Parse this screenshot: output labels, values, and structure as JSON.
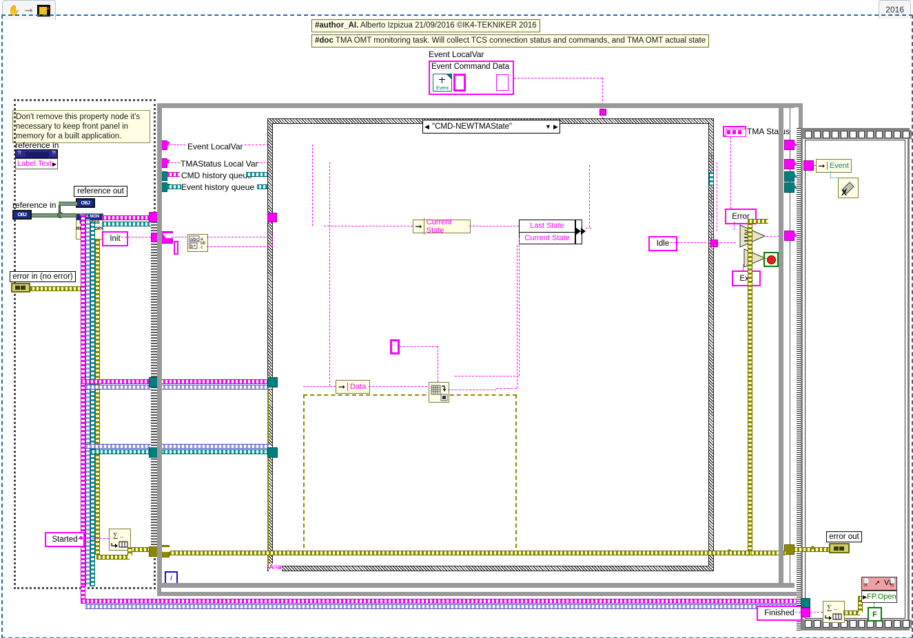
{
  "window": {
    "tab_year": "2016",
    "toolbar_icons": [
      "hand-icon",
      "arrow-icon",
      "vi-icon"
    ]
  },
  "documentation": {
    "author_tag": "#author_AI.",
    "author_text": "Alberto Izpizua 21/09/2016 ©IK4-TEKNIKER 2016",
    "doc_tag": "#doc",
    "doc_text": "TMA OMT monitoring task. Will collect TCS connection status and commands, and TMA OMT actual state"
  },
  "notes": {
    "property_note": "Don't remove this property node it's necessary to keep front panel in memory for a built application."
  },
  "controls": {
    "reference_in_top": "reference in",
    "reference_in": "reference in",
    "reference_out": "reference out",
    "error_in": "error in (no error)",
    "error_out": "error out",
    "obj_label": "OBJ"
  },
  "property_node": {
    "label_text": "Label.Text"
  },
  "event_local_var": {
    "title": "Event LocalVar",
    "inner_label": "Event Command Data",
    "glyph": "Event"
  },
  "tunnels": {
    "event_localvar": "Event LocalVar",
    "tmastatus_localvar": "TMAStatus Local Var",
    "cmd_history_queue": "CMD history queue",
    "event_history_queue": "Event history queue"
  },
  "case_structure": {
    "selector_value": "\"CMD-NEWTMAState\"",
    "left_arrow": "◀",
    "right_arrow": "▶",
    "dropdown_arrow": "▼",
    "inner_case_label": "A=a"
  },
  "subvis": {
    "repository_line1": "TMA MON",
    "repository_line2": "PROCESS",
    "repository_line3": "REPOSITORY"
  },
  "constants": {
    "init": "Init",
    "idle": "Idle",
    "exit": "Exit",
    "error": "Error",
    "started": "Started",
    "finished": "Finished",
    "false_const": "F"
  },
  "bundles": {
    "current_state_in": "Current State",
    "last_state": "Last State",
    "current_state": "Current State",
    "data": "Data",
    "event": "Event"
  },
  "indicators": {
    "tma_status": "TMA Status"
  },
  "vi_property": {
    "vi_label": "VI",
    "fp_open": "FP.Open"
  },
  "iteration_terminals": {
    "outer": "i",
    "inner": "i"
  }
}
